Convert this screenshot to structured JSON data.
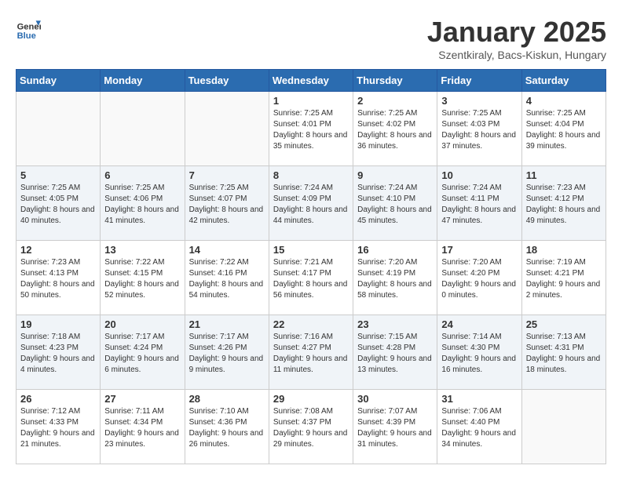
{
  "header": {
    "logo_general": "General",
    "logo_blue": "Blue",
    "month_title": "January 2025",
    "subtitle": "Szentkiraly, Bacs-Kiskun, Hungary"
  },
  "weekdays": [
    "Sunday",
    "Monday",
    "Tuesday",
    "Wednesday",
    "Thursday",
    "Friday",
    "Saturday"
  ],
  "weeks": [
    [
      {
        "day": "",
        "info": ""
      },
      {
        "day": "",
        "info": ""
      },
      {
        "day": "",
        "info": ""
      },
      {
        "day": "1",
        "info": "Sunrise: 7:25 AM\nSunset: 4:01 PM\nDaylight: 8 hours and 35 minutes."
      },
      {
        "day": "2",
        "info": "Sunrise: 7:25 AM\nSunset: 4:02 PM\nDaylight: 8 hours and 36 minutes."
      },
      {
        "day": "3",
        "info": "Sunrise: 7:25 AM\nSunset: 4:03 PM\nDaylight: 8 hours and 37 minutes."
      },
      {
        "day": "4",
        "info": "Sunrise: 7:25 AM\nSunset: 4:04 PM\nDaylight: 8 hours and 39 minutes."
      }
    ],
    [
      {
        "day": "5",
        "info": "Sunrise: 7:25 AM\nSunset: 4:05 PM\nDaylight: 8 hours and 40 minutes."
      },
      {
        "day": "6",
        "info": "Sunrise: 7:25 AM\nSunset: 4:06 PM\nDaylight: 8 hours and 41 minutes."
      },
      {
        "day": "7",
        "info": "Sunrise: 7:25 AM\nSunset: 4:07 PM\nDaylight: 8 hours and 42 minutes."
      },
      {
        "day": "8",
        "info": "Sunrise: 7:24 AM\nSunset: 4:09 PM\nDaylight: 8 hours and 44 minutes."
      },
      {
        "day": "9",
        "info": "Sunrise: 7:24 AM\nSunset: 4:10 PM\nDaylight: 8 hours and 45 minutes."
      },
      {
        "day": "10",
        "info": "Sunrise: 7:24 AM\nSunset: 4:11 PM\nDaylight: 8 hours and 47 minutes."
      },
      {
        "day": "11",
        "info": "Sunrise: 7:23 AM\nSunset: 4:12 PM\nDaylight: 8 hours and 49 minutes."
      }
    ],
    [
      {
        "day": "12",
        "info": "Sunrise: 7:23 AM\nSunset: 4:13 PM\nDaylight: 8 hours and 50 minutes."
      },
      {
        "day": "13",
        "info": "Sunrise: 7:22 AM\nSunset: 4:15 PM\nDaylight: 8 hours and 52 minutes."
      },
      {
        "day": "14",
        "info": "Sunrise: 7:22 AM\nSunset: 4:16 PM\nDaylight: 8 hours and 54 minutes."
      },
      {
        "day": "15",
        "info": "Sunrise: 7:21 AM\nSunset: 4:17 PM\nDaylight: 8 hours and 56 minutes."
      },
      {
        "day": "16",
        "info": "Sunrise: 7:20 AM\nSunset: 4:19 PM\nDaylight: 8 hours and 58 minutes."
      },
      {
        "day": "17",
        "info": "Sunrise: 7:20 AM\nSunset: 4:20 PM\nDaylight: 9 hours and 0 minutes."
      },
      {
        "day": "18",
        "info": "Sunrise: 7:19 AM\nSunset: 4:21 PM\nDaylight: 9 hours and 2 minutes."
      }
    ],
    [
      {
        "day": "19",
        "info": "Sunrise: 7:18 AM\nSunset: 4:23 PM\nDaylight: 9 hours and 4 minutes."
      },
      {
        "day": "20",
        "info": "Sunrise: 7:17 AM\nSunset: 4:24 PM\nDaylight: 9 hours and 6 minutes."
      },
      {
        "day": "21",
        "info": "Sunrise: 7:17 AM\nSunset: 4:26 PM\nDaylight: 9 hours and 9 minutes."
      },
      {
        "day": "22",
        "info": "Sunrise: 7:16 AM\nSunset: 4:27 PM\nDaylight: 9 hours and 11 minutes."
      },
      {
        "day": "23",
        "info": "Sunrise: 7:15 AM\nSunset: 4:28 PM\nDaylight: 9 hours and 13 minutes."
      },
      {
        "day": "24",
        "info": "Sunrise: 7:14 AM\nSunset: 4:30 PM\nDaylight: 9 hours and 16 minutes."
      },
      {
        "day": "25",
        "info": "Sunrise: 7:13 AM\nSunset: 4:31 PM\nDaylight: 9 hours and 18 minutes."
      }
    ],
    [
      {
        "day": "26",
        "info": "Sunrise: 7:12 AM\nSunset: 4:33 PM\nDaylight: 9 hours and 21 minutes."
      },
      {
        "day": "27",
        "info": "Sunrise: 7:11 AM\nSunset: 4:34 PM\nDaylight: 9 hours and 23 minutes."
      },
      {
        "day": "28",
        "info": "Sunrise: 7:10 AM\nSunset: 4:36 PM\nDaylight: 9 hours and 26 minutes."
      },
      {
        "day": "29",
        "info": "Sunrise: 7:08 AM\nSunset: 4:37 PM\nDaylight: 9 hours and 29 minutes."
      },
      {
        "day": "30",
        "info": "Sunrise: 7:07 AM\nSunset: 4:39 PM\nDaylight: 9 hours and 31 minutes."
      },
      {
        "day": "31",
        "info": "Sunrise: 7:06 AM\nSunset: 4:40 PM\nDaylight: 9 hours and 34 minutes."
      },
      {
        "day": "",
        "info": ""
      }
    ]
  ]
}
